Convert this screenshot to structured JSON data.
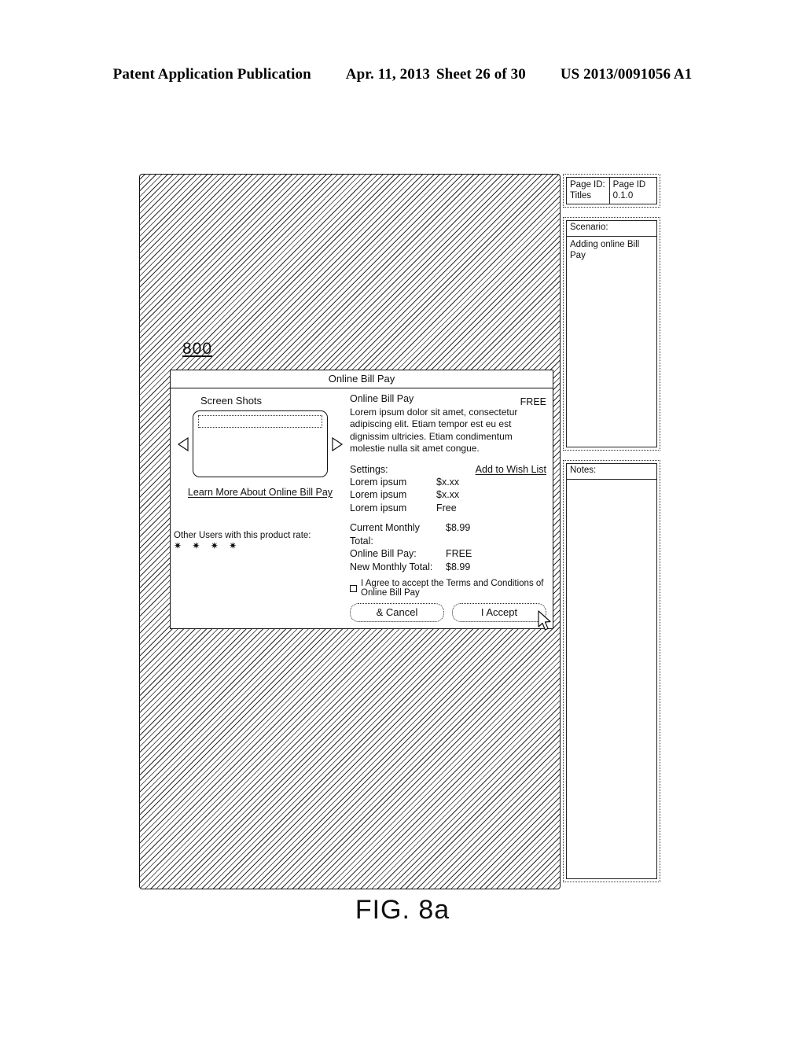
{
  "patent_header": {
    "publication": "Patent Application Publication",
    "date": "Apr. 11, 2013",
    "sheet": "Sheet 26 of 30",
    "number": "US 2013/0091056 A1"
  },
  "figure": {
    "caption": "FIG. 8a",
    "reference_numeral": "800"
  },
  "meta": {
    "page_id": {
      "label": "Page ID: Titles",
      "value": "Page ID 0.1.0"
    },
    "scenario": {
      "label": "Scenario:",
      "value": "Adding online Bill Pay"
    },
    "notes": {
      "label": "Notes:",
      "value": ""
    }
  },
  "dialog": {
    "title": "Online Bill Pay",
    "screen_shots": {
      "label": "Screen Shots",
      "prev_arrow": "left-arrow-icon",
      "next_arrow": "right-arrow-icon"
    },
    "learn_more_link": "Learn More About Online Bill Pay",
    "rating": {
      "label": "Other Users with this product rate:",
      "stars": "✷ ✷ ✷ ✷",
      "count": 4
    },
    "product": {
      "name": "Online Bill Pay",
      "price": "FREE",
      "description": "Lorem ipsum dolor sit amet, consectetur adipiscing elit. Etiam tempor est eu est dignissim ultricies. Etiam condimentum molestie nulla sit amet congue."
    },
    "settings": {
      "label": "Settings:",
      "wish_list_link": "Add to Wish List",
      "rows": [
        {
          "name": "Lorem ipsum",
          "value": "$x.xx"
        },
        {
          "name": "Lorem ipsum",
          "value": "$x.xx"
        },
        {
          "name": "Lorem ipsum",
          "value": "Free"
        }
      ]
    },
    "totals": [
      {
        "name": "Current Monthly Total:",
        "value": "$8.99"
      },
      {
        "name": "Online Bill Pay:",
        "value": "FREE"
      },
      {
        "name": "New Monthly Total:",
        "value": "$8.99"
      }
    ],
    "terms": {
      "checkbox_checked": false,
      "text": "I Agree to accept the Terms and Conditions of Online Bill Pay"
    },
    "buttons": {
      "cancel": "& Cancel",
      "accept": "I Accept"
    }
  }
}
